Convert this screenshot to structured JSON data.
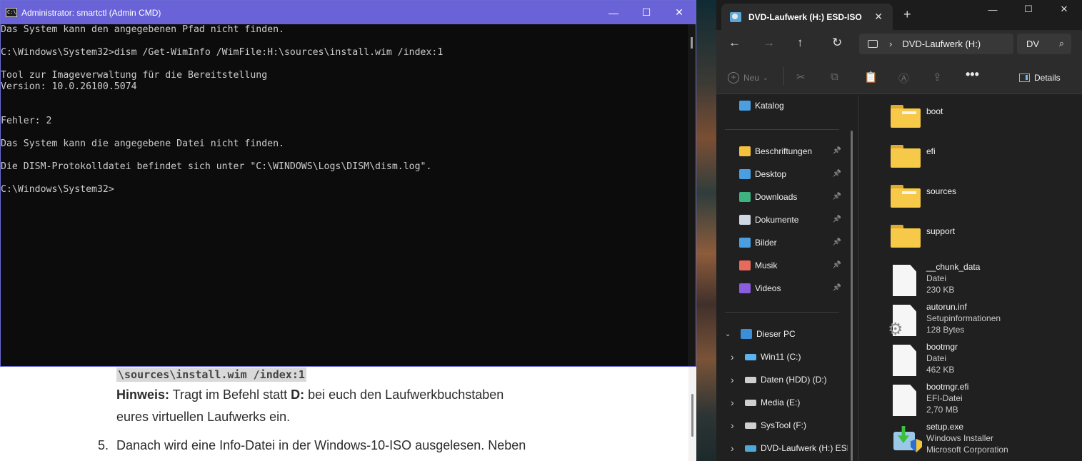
{
  "webpage": {
    "code_fragment": "\\sources\\install.wim /index:1",
    "hint_label": "Hinweis:",
    "hint_text_a": " Tragt im Befehl statt ",
    "hint_bold": "D:",
    "hint_text_b": " bei euch den Laufwerkbuchstaben",
    "hint_text_c": "eures virtuellen Laufwerks ein.",
    "step_number": "5.",
    "step_text": "Danach wird eine Info-Datei in der Windows-10-ISO ausgelesen. Neben"
  },
  "cmd": {
    "title": "Administrator: smartctl (Admin CMD)",
    "lines": [
      "Das System kann den angegebenen Pfad nicht finden.",
      "",
      "C:\\Windows\\System32>dism /Get-WimInfo /WimFile:H:\\sources\\install.wim /index:1",
      "",
      "Tool zur Imageverwaltung für die Bereitstellung",
      "Version: 10.0.26100.5074",
      "",
      "",
      "Fehler: 2",
      "",
      "Das System kann die angegebene Datei nicht finden.",
      "",
      "Die DISM-Protokolldatei befindet sich unter \"C:\\WINDOWS\\Logs\\DISM\\dism.log\".",
      "",
      "C:\\Windows\\System32>"
    ],
    "controls": {
      "minimize": "—",
      "maximize": "☐",
      "close": "✕"
    }
  },
  "explorer": {
    "tab_title": "DVD-Laufwerk (H:) ESD-ISO",
    "tab_close": "✕",
    "new_tab": "+",
    "window_controls": {
      "minimize": "—",
      "maximize": "☐",
      "close": "✕"
    },
    "address_path": "DVD-Laufwerk (H:)",
    "search_text": "DV",
    "toolbar": {
      "new_label": "Neu",
      "details_label": "Details",
      "more": "•••"
    },
    "nav_top": {
      "label": "Katalog"
    },
    "quick_access": [
      {
        "label": "Beschriftungen",
        "icon": "folder-icon",
        "color": "#f3c13e"
      },
      {
        "label": "Desktop",
        "icon": "desktop-icon",
        "color": "#4a9fe0"
      },
      {
        "label": "Downloads",
        "icon": "download-icon",
        "color": "#3fb37f"
      },
      {
        "label": "Dokumente",
        "icon": "document-icon",
        "color": "#cfd8e2"
      },
      {
        "label": "Bilder",
        "icon": "pictures-icon",
        "color": "#4a9fe0"
      },
      {
        "label": "Musik",
        "icon": "music-icon",
        "color": "#e86a5a"
      },
      {
        "label": "Videos",
        "icon": "video-icon",
        "color": "#8a5ce0"
      }
    ],
    "this_pc": {
      "label": "Dieser PC"
    },
    "drives": [
      {
        "label": "Win11 (C:)",
        "icon": "windows-drive-icon"
      },
      {
        "label": "Daten (HDD) (D:)",
        "icon": "drive-icon"
      },
      {
        "label": "Media (E:)",
        "icon": "drive-icon"
      },
      {
        "label": "SysTool (F:)",
        "icon": "drive-icon"
      },
      {
        "label": "DVD-Laufwerk (H:) ESD",
        "icon": "dvd-drive-icon"
      }
    ],
    "files": [
      {
        "name": "boot",
        "type": "folder",
        "paper": true
      },
      {
        "name": "efi",
        "type": "folder",
        "paper": false
      },
      {
        "name": "sources",
        "type": "folder",
        "paper": true
      },
      {
        "name": "support",
        "type": "folder",
        "paper": false
      },
      {
        "name": "__chunk_data",
        "type": "file",
        "line1": "Datei",
        "line2": "230 KB"
      },
      {
        "name": "autorun.inf",
        "type": "settings-file",
        "line1": "Setupinformationen",
        "line2": "128 Bytes"
      },
      {
        "name": "bootmgr",
        "type": "file",
        "line1": "Datei",
        "line2": "462 KB"
      },
      {
        "name": "bootmgr.efi",
        "type": "file",
        "line1": "EFI-Datei",
        "line2": "2,70 MB"
      },
      {
        "name": "setup.exe",
        "type": "installer",
        "line1": "Windows Installer",
        "line2": "Microsoft Corporation"
      }
    ]
  }
}
